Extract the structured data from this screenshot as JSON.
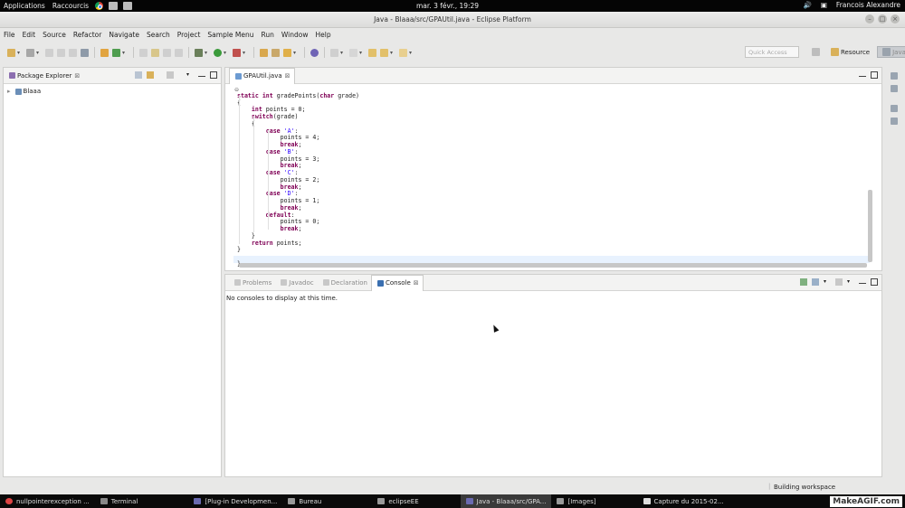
{
  "topbar": {
    "applications": "Applications",
    "shortcuts": "Raccourcis",
    "clock": "mar. 3 févr., 19:29",
    "user": "Francois Alexandre"
  },
  "window": {
    "title": "Java - Blaaa/src/GPAUtil.java - Eclipse Platform"
  },
  "menu": [
    "File",
    "Edit",
    "Source",
    "Refactor",
    "Navigate",
    "Search",
    "Project",
    "Sample Menu",
    "Run",
    "Window",
    "Help"
  ],
  "toolbar": {
    "quick_access_placeholder": "Quick Access",
    "perspective_resource": "Resource",
    "perspective_java": "Java"
  },
  "package_explorer": {
    "title": "Package Explorer",
    "project": "Blaaa"
  },
  "editor": {
    "tab": "GPAUtil.java",
    "lines": [
      "static int gradePoints(char grade)",
      "{",
      "    int points = 0;",
      "    switch(grade)",
      "    {",
      "        case 'A':",
      "            points = 4;",
      "            break;",
      "        case 'B':",
      "            points = 3;",
      "            break;",
      "        case 'C':",
      "            points = 2;",
      "            break;",
      "        case 'D':",
      "            points = 1;",
      "            break;",
      "        default:",
      "            points = 0;",
      "            break;",
      "    }",
      "    return points;",
      "}",
      "",
      "}"
    ]
  },
  "bottom_panel": {
    "tabs": [
      "Problems",
      "Javadoc",
      "Declaration",
      "Console"
    ],
    "active_tab": "Console",
    "message": "No consoles to display at this time."
  },
  "status": {
    "building": "Building workspace"
  },
  "taskbar": {
    "items": [
      "nullpointerexception ...",
      "Terminal",
      "[Plug-in Developmen...",
      "Bureau",
      "eclipseEE",
      "Java - Blaaa/src/GPA...",
      "[Images]",
      "Capture du 2015-02..."
    ],
    "watermark": "MakeAGIF.com"
  }
}
